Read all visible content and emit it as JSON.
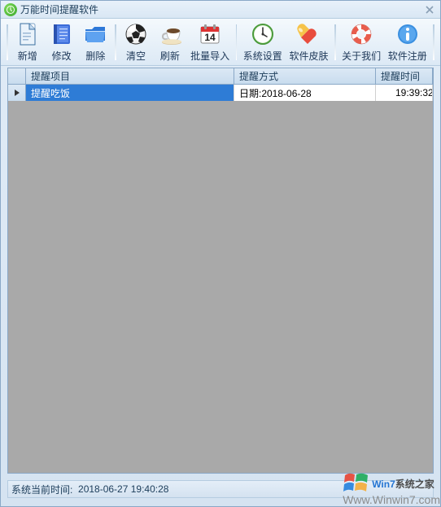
{
  "title": "万能时间提醒软件",
  "toolbar": [
    {
      "name": "add",
      "label": "新增"
    },
    {
      "name": "edit",
      "label": "修改"
    },
    {
      "name": "delete",
      "label": "删除"
    },
    {
      "name": "clear",
      "label": "清空"
    },
    {
      "name": "refresh",
      "label": "刷新"
    },
    {
      "name": "import",
      "label": "批量导入"
    },
    {
      "name": "settings",
      "label": "系统设置"
    },
    {
      "name": "skin",
      "label": "软件皮肤"
    },
    {
      "name": "about",
      "label": "关于我们"
    },
    {
      "name": "register",
      "label": "软件注册"
    }
  ],
  "columns": {
    "name": "提醒项目",
    "method": "提醒方式",
    "time": "提醒时间"
  },
  "rows": [
    {
      "name": "提醒吃饭",
      "method": "日期:2018-06-28",
      "time": "19:39:32",
      "selected": true
    }
  ],
  "status": {
    "label": "系统当前时间:",
    "value": "2018-06-27 19:40:28"
  },
  "watermark": {
    "brand_prefix": "Win7",
    "brand_suffix": "系统之家",
    "url": "Www.Winwin7.com"
  }
}
